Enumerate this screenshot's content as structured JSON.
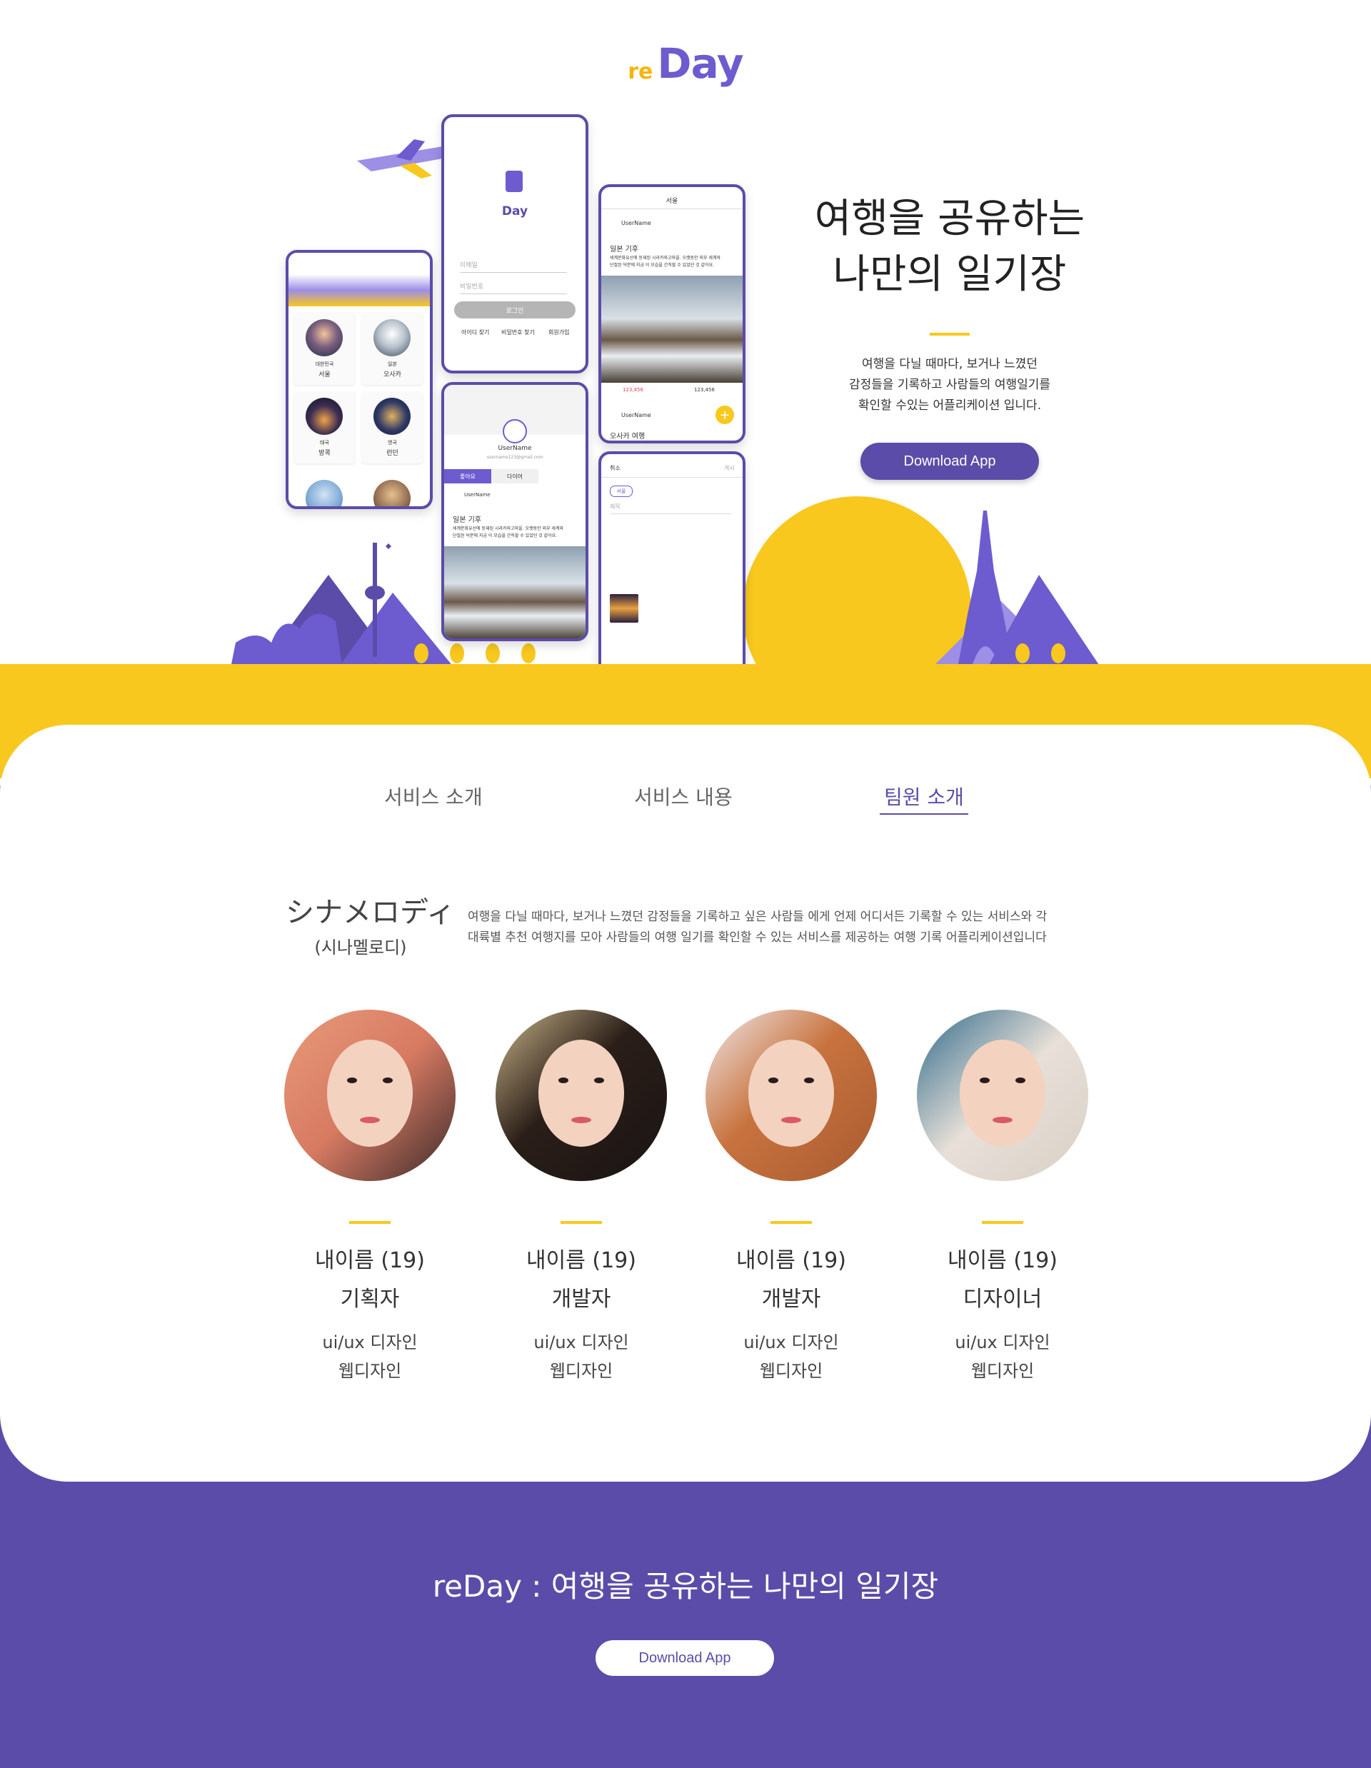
{
  "brand": {
    "prefix": "re",
    "name": "Day"
  },
  "hero": {
    "headline_line1": "여행을 공유하는",
    "headline_line2": "나만의 일기장",
    "desc_line1": "여행을 다닐 때마다, 보거나 느꼈던",
    "desc_line2": "감정들을 기록하고 사람들의 여행일기를",
    "desc_line3": "확인할 수있는 어플리케이션 입니다.",
    "download_label": "Download App"
  },
  "phones": {
    "home": {
      "cities": [
        {
          "country": "대한민국",
          "city": "서울"
        },
        {
          "country": "일본",
          "city": "오사카"
        },
        {
          "country": "태국",
          "city": "방콕"
        },
        {
          "country": "영국",
          "city": "런던"
        }
      ]
    },
    "login": {
      "id_placeholder": "이메일",
      "pw_placeholder": "비밀번호",
      "login_label": "로그인",
      "link_find_id": "아이디 찾기",
      "link_find_pw": "비밀번호 찾기",
      "link_signup": "회원가입"
    },
    "feed": {
      "title": "서울",
      "username": "UserName",
      "post_title": "일본 기후",
      "post_body1": "세계문화유산에 등재된 시라카와고마을. 오랫동안 외부 세계와",
      "post_body2": "단절된 덕분에 지금 이 모습을 간직할 수 있었던 것 같아요.",
      "likes": "123,456",
      "comments": "123,456",
      "username2": "UserName",
      "post_title2": "오사카 여행"
    },
    "profile": {
      "username": "UserName",
      "email": "username123@gmail.com",
      "tab_likes": "좋아요",
      "tab_diary": "다이어",
      "post_username": "UserName",
      "post_title": "일본 기후",
      "post_body1": "세계문화유산에 등재된 시라카와고마을. 오랫동안 외부 세계와",
      "post_body2": "단절된 덕분에 지금 이 모습을 간직할 수 있었던 것 같아요."
    },
    "write": {
      "cancel": "취소",
      "post": "게시",
      "tag": "서울",
      "title_placeholder": "제목"
    }
  },
  "nav": {
    "tab1": "서비스 소개",
    "tab2": "서비스 내용",
    "tab3": "팀원 소개"
  },
  "team": {
    "name_jp": "シナメロディ",
    "name_kr": "(시나멜로디)",
    "desc_line1": "여행을 다닐 때마다, 보거나 느꼈던 감정들을 기록하고 싶은 사람들 에게 언제 어디서든 기록할 수 있는 서비스와 각",
    "desc_line2": "대륙별 추천 여행지를 모아 사람들의 여행 일기를 확인할 수 있는 서비스를 제공하는 여행 기록 어플리케이션입니다",
    "members": [
      {
        "name": "내이름 (19)",
        "role": "기획자",
        "skill1": "ui/ux 디자인",
        "skill2": "웹디자인"
      },
      {
        "name": "내이름 (19)",
        "role": "개발자",
        "skill1": "ui/ux 디자인",
        "skill2": "웹디자인"
      },
      {
        "name": "내이름 (19)",
        "role": "개발자",
        "skill1": "ui/ux 디자인",
        "skill2": "웹디자인"
      },
      {
        "name": "내이름 (19)",
        "role": "디자이너",
        "skill1": "ui/ux 디자인",
        "skill2": "웹디자인"
      }
    ]
  },
  "footer": {
    "title": "reDay : 여행을 공유하는 나만의 일기장",
    "download_label": "Download App"
  },
  "colors": {
    "purple": "#5b4ca9",
    "light_purple": "#9d8ee6",
    "yellow": "#f8c81e"
  }
}
